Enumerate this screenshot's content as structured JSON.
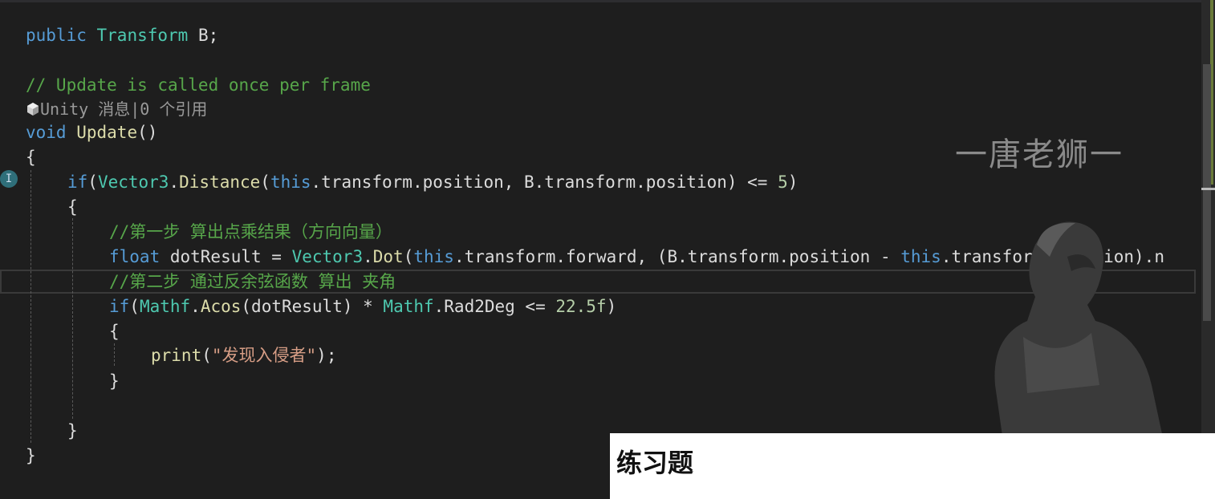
{
  "code": {
    "l1": {
      "kw": "public",
      "type": "Transform",
      "rest": " B;"
    },
    "l2": {
      "comment": "// Update is called once per frame"
    },
    "l3": {
      "lens": "Unity 消息|0 个引用"
    },
    "l4": {
      "kw": "void",
      "fn": "Update",
      "rest": "()"
    },
    "l5": {
      "brace": "{"
    },
    "l6": {
      "kw": "if",
      "p1": "(",
      "type": "Vector3",
      "dot": ".",
      "fn": "Distance",
      "p2": "(",
      "kw2": "this",
      "rest": ".transform.position, B.transform.position) <= ",
      "num": "5",
      "end": ")"
    },
    "l7": {
      "brace": "{"
    },
    "l8": {
      "comment": "//第一步 算出点乘结果（方向向量）"
    },
    "l9": {
      "kw": "float",
      "var": " dotResult = ",
      "type": "Vector3",
      "dot": ".",
      "fn": "Dot",
      "p": "(",
      "kw2": "this",
      "mid": ".transform.forward, (B.transform.position - ",
      "kw3": "this",
      "rest": ".transform.position).n"
    },
    "l10": {
      "comment": "//第二步 通过反余弦函数 算出 夹角"
    },
    "l11": {
      "kw": "if",
      "p1": "(",
      "type": "Mathf",
      "dot": ".",
      "fn": "Acos",
      "mid": "(dotResult) * ",
      "type2": "Mathf",
      "rest": ".Rad2Deg <= ",
      "num": "22.5f",
      "end": ")"
    },
    "l12": {
      "brace": "{"
    },
    "l13": {
      "fn": "print",
      "p": "(",
      "str": "\"发现入侵者\"",
      "end": ");"
    },
    "l14": {
      "brace": "}"
    },
    "l15": {
      "brace": "}"
    },
    "l16": {
      "brace": "}"
    }
  },
  "gutter": {
    "marker": "I"
  },
  "watermark": "一唐老狮一",
  "panel": {
    "title": "练习题"
  },
  "colors": {
    "background": "#1e1e1e",
    "keyword": "#569cd6",
    "type": "#4ec9b0",
    "function": "#dcdcaa",
    "comment": "#57a64a",
    "number": "#b5cea8",
    "string": "#d69d85"
  }
}
